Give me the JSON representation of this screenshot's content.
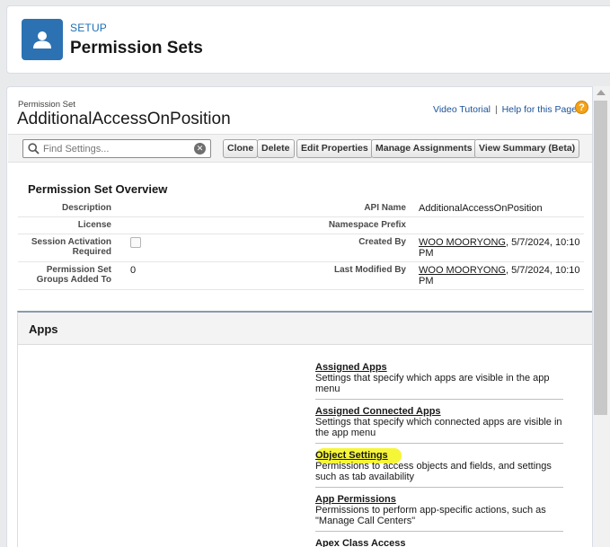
{
  "header": {
    "setup_label": "SETUP",
    "title": "Permission Sets",
    "icon": "user-icon"
  },
  "permission_set": {
    "label": "Permission Set",
    "name": "AdditionalAccessOnPosition"
  },
  "help": {
    "video_tutorial": "Video Tutorial",
    "separator": "|",
    "help_page": "Help for this Page",
    "help_icon_glyph": "?"
  },
  "toolbar": {
    "search_placeholder": "Find Settings...",
    "clear_glyph": "✕",
    "buttons": [
      "Clone",
      "Delete",
      "Edit Properties",
      "Manage Assignments",
      "View Summary (Beta)"
    ]
  },
  "overview": {
    "title": "Permission Set Overview",
    "description_label": "Description",
    "description_value": "",
    "license_label": "License",
    "license_value": "",
    "session_activation_label": "Session Activation Required",
    "session_activation_checked": false,
    "groups_added_label": "Permission Set Groups Added To",
    "groups_added_value": "0",
    "api_name_label": "API Name",
    "api_name_value": "AdditionalAccessOnPosition",
    "namespace_label": "Namespace Prefix",
    "namespace_value": "",
    "created_by_label": "Created By",
    "created_by_user": "WOO MOORYONG",
    "created_by_date": ", 5/7/2024, 10:10 PM",
    "modified_by_label": "Last Modified By",
    "modified_by_user": "WOO MOORYONG",
    "modified_by_date": ", 5/7/2024, 10:10 PM"
  },
  "apps": {
    "title": "Apps",
    "items": [
      {
        "label": "Assigned Apps",
        "desc": "Settings that specify which apps are visible in the app menu"
      },
      {
        "label": "Assigned Connected Apps",
        "desc": "Settings that specify which connected apps are visible in the app menu"
      },
      {
        "label": "Object Settings",
        "desc": "Permissions to access objects and fields, and settings such as tab availability"
      },
      {
        "label": "App Permissions",
        "desc": "Permissions to perform app-specific actions, such as \"Manage Call Centers\""
      },
      {
        "label": "Apex Class Access",
        "desc": ""
      }
    ]
  },
  "colors": {
    "brand_blue": "#2c72b2",
    "link_blue": "#1b5297",
    "highlight_yellow": "#f4f416",
    "help_orange": "#f3a31b"
  }
}
